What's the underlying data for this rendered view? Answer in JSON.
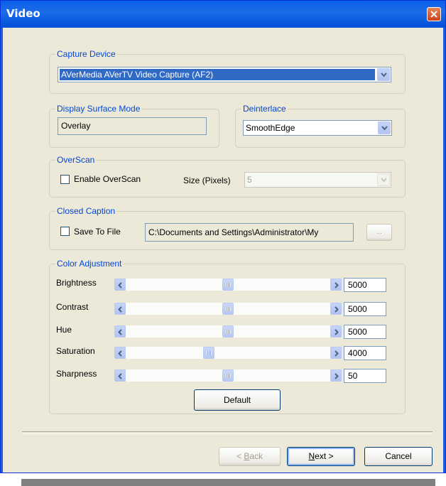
{
  "window": {
    "title": "Video"
  },
  "capture_device": {
    "legend": "Capture Device",
    "selected": "AVerMedia AVerTV Video Capture (AF2)"
  },
  "display_surface": {
    "legend": "Display Surface Mode",
    "value": "Overlay"
  },
  "deinterlace": {
    "legend": "Deinterlace",
    "selected": "SmoothEdge"
  },
  "overscan": {
    "legend": "OverScan",
    "enable_label": "Enable OverScan",
    "enabled": false,
    "size_label": "Size (Pixels)",
    "size_value": "5"
  },
  "closed_caption": {
    "legend": "Closed Caption",
    "save_label": "Save To File",
    "save_checked": false,
    "path": "C:\\Documents and Settings\\Administrator\\My",
    "browse_label": "..."
  },
  "color_adjustment": {
    "legend": "Color Adjustment",
    "sliders": [
      {
        "label": "Brightness",
        "value": "5000",
        "level": 0.5
      },
      {
        "label": "Contrast",
        "value": "5000",
        "level": 0.5
      },
      {
        "label": "Hue",
        "value": "5000",
        "level": 0.5
      },
      {
        "label": "Saturation",
        "value": "4000",
        "level": 0.4
      },
      {
        "label": "Sharpness",
        "value": "50",
        "level": 0.5
      }
    ],
    "default_label": "Default"
  },
  "footer": {
    "back_prefix": "< ",
    "back_key": "B",
    "back_rest": "ack",
    "next_key": "N",
    "next_rest": "ext >",
    "cancel_label": "Cancel"
  },
  "colors": {
    "titlebar": "#0A5FE8",
    "dialog_bg": "#ECE9D8",
    "group_legend": "#0046D5",
    "selection": "#316AC5"
  }
}
